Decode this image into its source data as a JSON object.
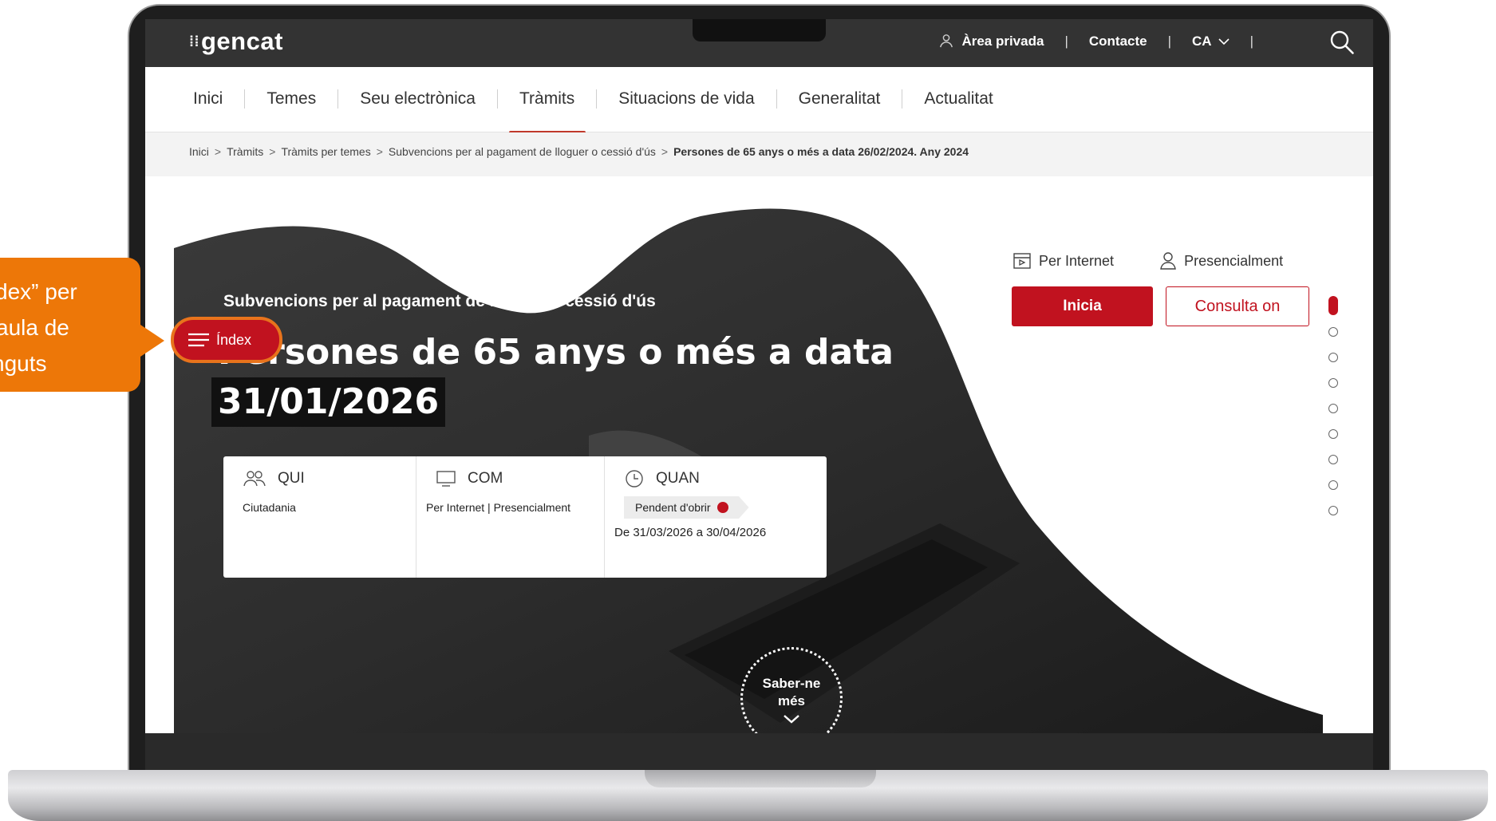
{
  "header": {
    "logo": "gencat",
    "private_area": "Àrea privada",
    "contact": "Contacte",
    "language": "CA"
  },
  "nav": [
    "Inici",
    "Temes",
    "Seu electrònica",
    "Tràmits",
    "Situacions de vida",
    "Generalitat",
    "Actualitat"
  ],
  "breadcrumb": [
    "Inici",
    "Tràmits",
    "Tràmits per temes",
    "Subvencions per al pagament de lloguer o cessió d'ús",
    "Persones de 65 anys o més a data 26/02/2024. Any 2024"
  ],
  "hero": {
    "subtitle": "Subvencions per al pagament de lloguer o cessió d'ús",
    "title_line1": "Persones de 65 anys o més a data",
    "title_line2": "31/01/2026",
    "learn_more_1": "Saber-ne",
    "learn_more_2": "més"
  },
  "summary": {
    "who": {
      "label": "QUI",
      "value": "Ciutadania"
    },
    "how": {
      "label": "COM",
      "value": "Per Internet | Presencialment"
    },
    "when": {
      "label": "QUAN",
      "status": "Pendent d'obrir",
      "dates": "De 31/03/2026 a 30/04/2026"
    }
  },
  "actions": {
    "internet": "Per Internet",
    "in_person": "Presencialment",
    "start": "Inicia",
    "check": "Consulta on"
  },
  "index": {
    "label": "Índex"
  },
  "callout": {
    "line1": "dex” per",
    "line2": "aula de",
    "line3": "nguts"
  },
  "colors": {
    "accent_red": "#c1121f",
    "callout_orange": "#ed7708",
    "header_dark": "#333333"
  }
}
